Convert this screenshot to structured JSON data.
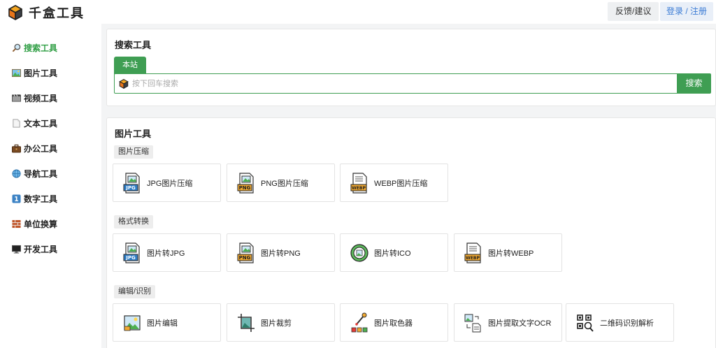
{
  "header": {
    "app_title": "千盒工具",
    "feedback_label": "反馈/建议",
    "login_label": "登录 / 注册"
  },
  "sidebar": {
    "items": [
      {
        "label": "搜索工具",
        "icon": "magnifier-icon",
        "active": true
      },
      {
        "label": "图片工具",
        "icon": "picture-icon"
      },
      {
        "label": "视频工具",
        "icon": "film-icon"
      },
      {
        "label": "文本工具",
        "icon": "document-icon"
      },
      {
        "label": "办公工具",
        "icon": "briefcase-icon"
      },
      {
        "label": "导航工具",
        "icon": "globe-icon"
      },
      {
        "label": "数字工具",
        "icon": "number-one-icon"
      },
      {
        "label": "单位换算",
        "icon": "bricks-icon"
      },
      {
        "label": "开发工具",
        "icon": "monitor-icon"
      }
    ]
  },
  "search": {
    "title": "搜索工具",
    "tab_label": "本站",
    "placeholder": "按下回车搜索",
    "value": "",
    "button_label": "搜索"
  },
  "image_tools": {
    "title": "图片工具",
    "sections": [
      {
        "label": "图片压缩",
        "tools": [
          {
            "label": "JPG图片压缩",
            "icon": "jpg-file-icon"
          },
          {
            "label": "PNG图片压缩",
            "icon": "png-file-icon"
          },
          {
            "label": "WEBP图片压缩",
            "icon": "webp-file-icon"
          }
        ]
      },
      {
        "label": "格式转换",
        "tools": [
          {
            "label": "图片转JPG",
            "icon": "jpg-file-icon"
          },
          {
            "label": "图片转PNG",
            "icon": "png-file-icon"
          },
          {
            "label": "图片转ICO",
            "icon": "ico-convert-icon"
          },
          {
            "label": "图片转WEBP",
            "icon": "webp-file-icon"
          }
        ]
      },
      {
        "label": "编辑/识别",
        "tools": [
          {
            "label": "图片编辑",
            "icon": "image-edit-icon"
          },
          {
            "label": "图片裁剪",
            "icon": "crop-icon"
          },
          {
            "label": "图片取色器",
            "icon": "color-picker-icon"
          },
          {
            "label": "图片提取文字OCR",
            "icon": "ocr-icon"
          },
          {
            "label": "二维码识别解析",
            "icon": "qr-scan-icon"
          }
        ]
      }
    ]
  },
  "colors": {
    "accent_green": "#3f9e53",
    "login_blue": "#3a7bd5"
  }
}
